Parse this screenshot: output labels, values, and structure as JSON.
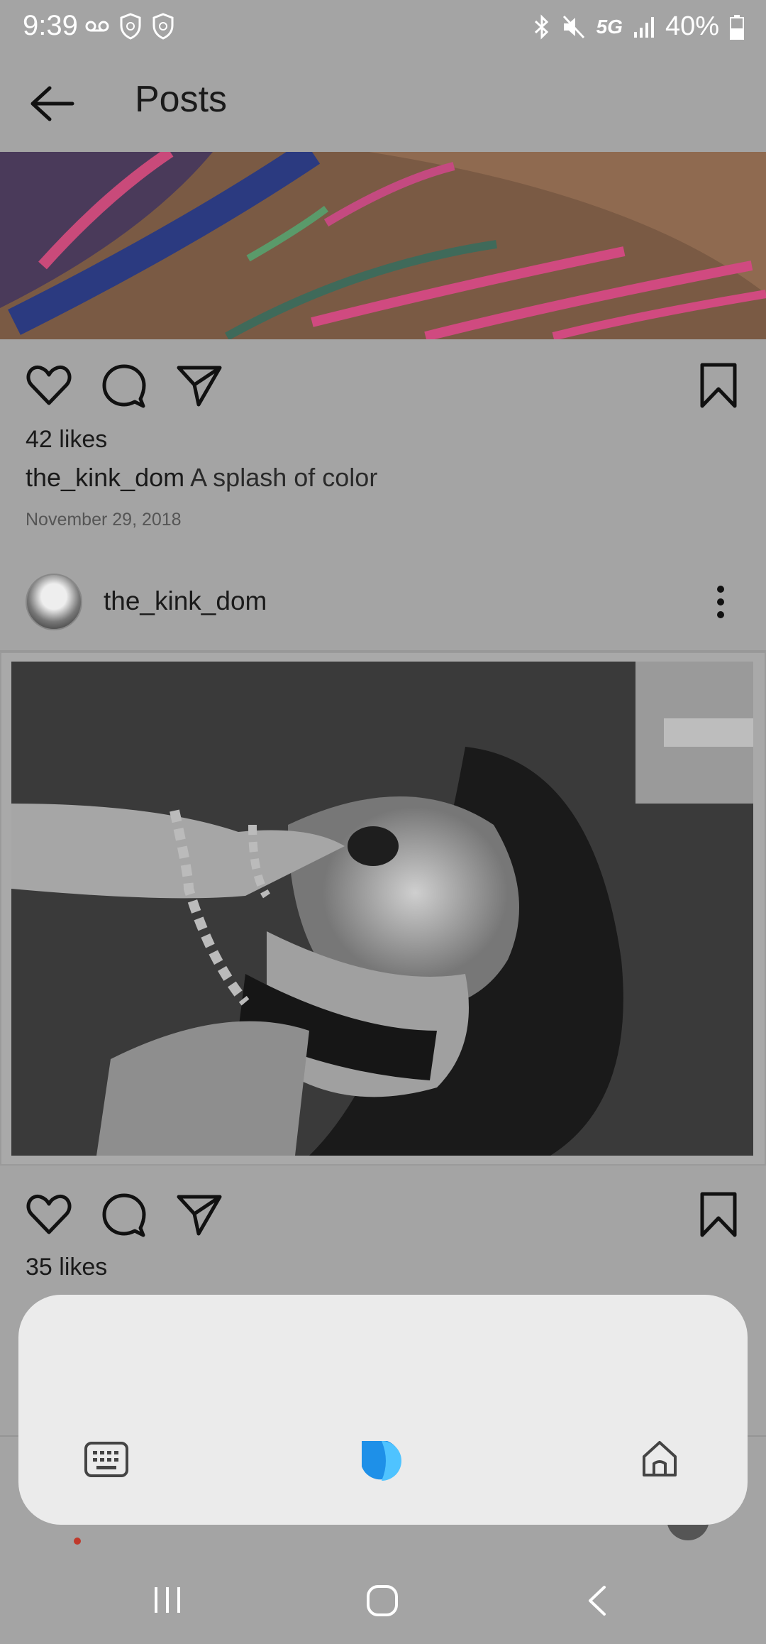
{
  "status_bar": {
    "time": "9:39",
    "network": "5G",
    "battery": "40%"
  },
  "header": {
    "title": "Posts"
  },
  "post1": {
    "likes": "42 likes",
    "username": "the_kink_dom",
    "caption": "A splash of color",
    "date": "November 29, 2018"
  },
  "post2": {
    "username": "the_kink_dom",
    "likes": "35 likes"
  },
  "icons": {
    "back": "arrow-left-icon",
    "like": "heart-icon",
    "comment": "comment-icon",
    "share": "send-icon",
    "save": "bookmark-icon",
    "more": "more-vertical-icon",
    "keyboard": "keyboard-icon",
    "assistant": "assistant-icon",
    "home": "home-icon"
  },
  "colors": {
    "background": "#a4a4a4",
    "panel": "#ebebeb",
    "assistant_blue": "#29a8f5",
    "notification_dot": "#c0392b"
  }
}
